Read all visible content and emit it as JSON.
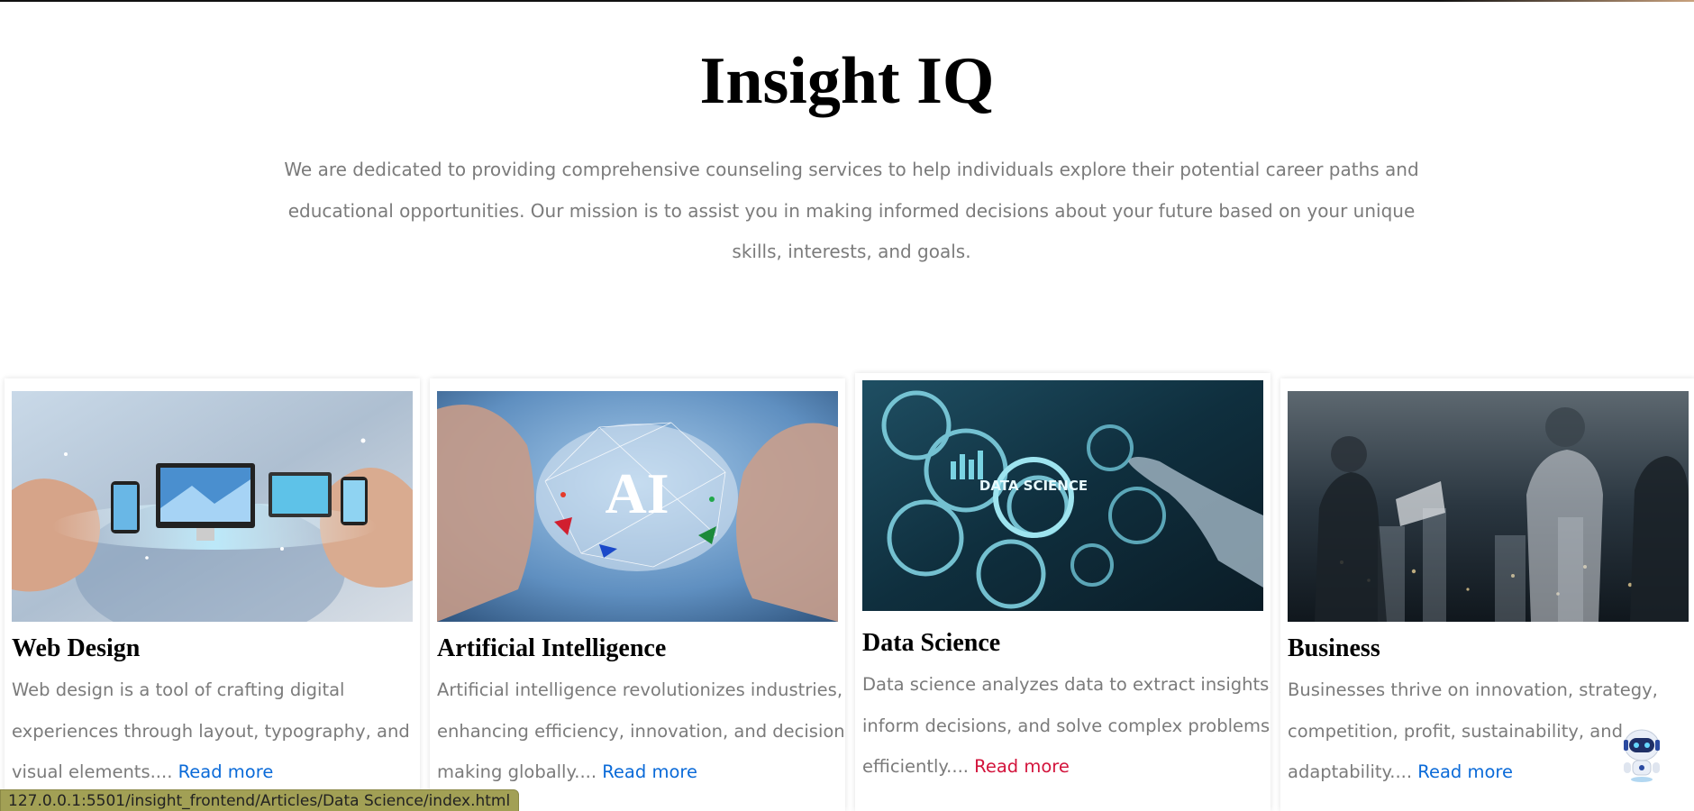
{
  "header": {
    "title": "Insight IQ",
    "intro": "We are dedicated to providing comprehensive counseling services to help individuals explore their potential career paths and educational opportunities. Our mission is to assist you in making informed decisions about your future based on your unique skills, interests, and goals."
  },
  "cards": [
    {
      "title": "Web Design",
      "text": "Web design is a tool of crafting digital experiences through layout, typography, and visual elements....",
      "link": "Read more"
    },
    {
      "title": "Artificial Intelligence",
      "text": "Artificial intelligence revolutionizes industries, enhancing efficiency, innovation, and decision-making globally....",
      "link": "Read more",
      "image_label": "AI"
    },
    {
      "title": "Data Science",
      "text": "Data science analyzes data to extract insights, inform decisions, and solve complex problems efficiently....",
      "link": "Read more",
      "image_label": "DATA SCIENCE"
    },
    {
      "title": "Business",
      "text": "Businesses thrive on innovation, strategy, competition, profit, sustainability, and adaptability....",
      "link": "Read more"
    }
  ],
  "status_bar": {
    "url": "127.0.0.1:5501/insight_frontend/Articles/Data Science/index.html"
  },
  "chatbot": {
    "icon": "robot-icon"
  },
  "colors": {
    "link": "#0a6ad8",
    "link_hover": "#d3143c",
    "body_text": "#7b7b7b",
    "status_bar": "#a2a055"
  }
}
